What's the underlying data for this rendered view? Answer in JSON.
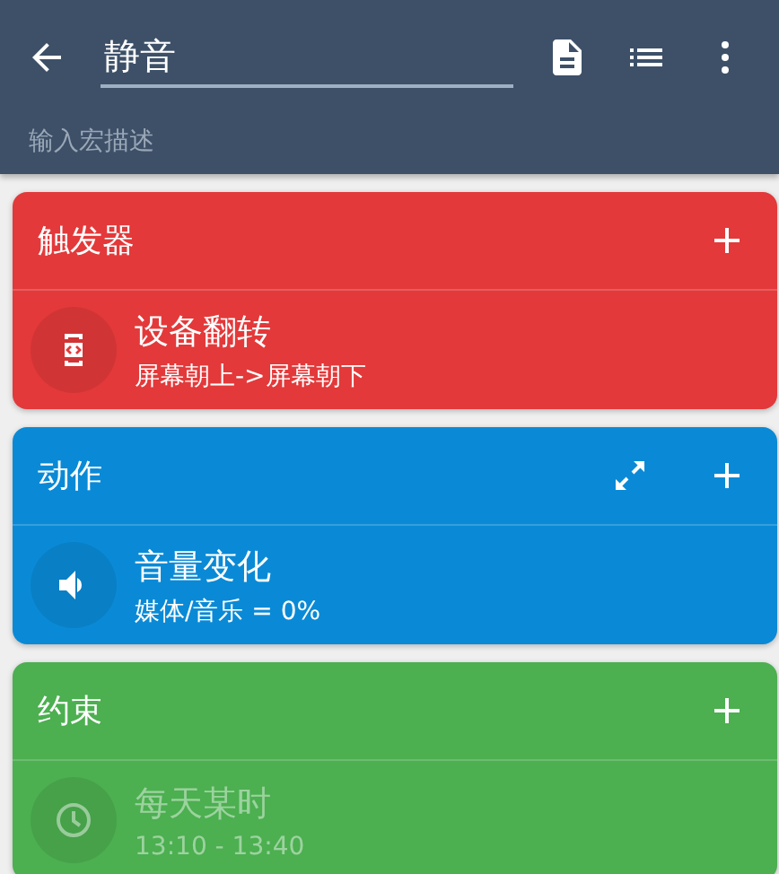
{
  "toolbar": {
    "title": "静音",
    "description_placeholder": "输入宏描述"
  },
  "sections": [
    {
      "title": "触发器",
      "color": "#e3393a",
      "expandable": false,
      "items": [
        {
          "kind": "flip",
          "title": "设备翻转",
          "detail": "屏幕朝上->屏幕朝下",
          "disabled": false
        }
      ]
    },
    {
      "title": "动作",
      "color": "#0a8ad6",
      "expandable": true,
      "items": [
        {
          "kind": "volume",
          "title": "音量变化",
          "detail": "媒体/音乐 = 0%",
          "disabled": false
        }
      ]
    },
    {
      "title": "约束",
      "color": "#4caf50",
      "expandable": false,
      "items": [
        {
          "kind": "clock",
          "title": "每天某时",
          "detail": "13:10 - 13:40",
          "disabled": true
        }
      ]
    }
  ]
}
